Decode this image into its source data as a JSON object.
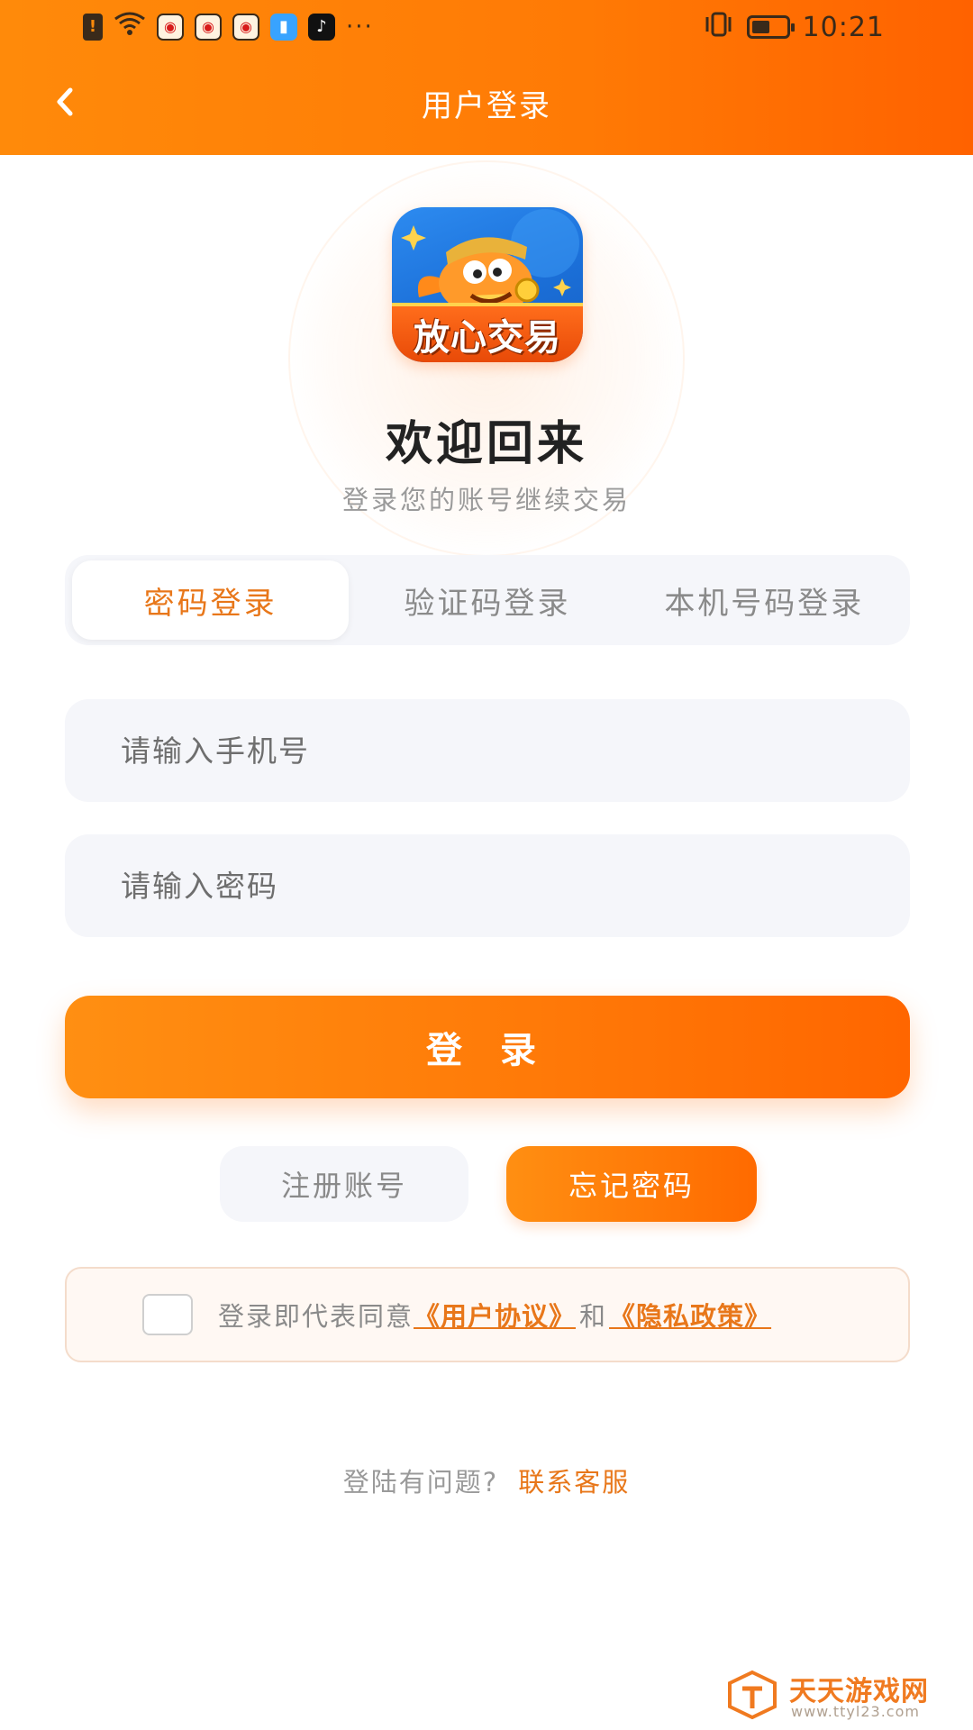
{
  "status_bar": {
    "time": "10:21",
    "left_icons": [
      "warning-icon",
      "wifi-icon",
      "weibo-icon",
      "weibo-icon",
      "weibo-icon",
      "book-icon",
      "tiktok-icon",
      "more-dots-icon"
    ],
    "more": "···"
  },
  "header": {
    "title": "用户登录",
    "back_icon": "chevron-left-icon"
  },
  "logo": {
    "text": "放心交易"
  },
  "welcome": {
    "title": "欢迎回来",
    "subtitle": "登录您的账号继续交易"
  },
  "tabs": [
    {
      "label": "密码登录",
      "active": true
    },
    {
      "label": "验证码登录",
      "active": false
    },
    {
      "label": "本机号码登录",
      "active": false
    }
  ],
  "form": {
    "phone_placeholder": "请输入手机号",
    "password_placeholder": "请输入密码",
    "phone_value": "",
    "password_value": ""
  },
  "login_button": "登 录",
  "register_button": "注册账号",
  "forgot_button": "忘记密码",
  "agreement": {
    "checked": false,
    "prefix": "登录即代表同意",
    "user_agreement": "《用户协议》",
    "and": "和",
    "privacy_policy": "《隐私政策》"
  },
  "help": {
    "question": "登陆有问题?",
    "contact": "联系客服"
  },
  "watermark": {
    "name": "天天游戏网",
    "url": "www.ttyl23.com"
  },
  "colors": {
    "accent": "#ff7a08",
    "accent_text": "#e8771a",
    "field_bg": "#f5f6fa"
  }
}
